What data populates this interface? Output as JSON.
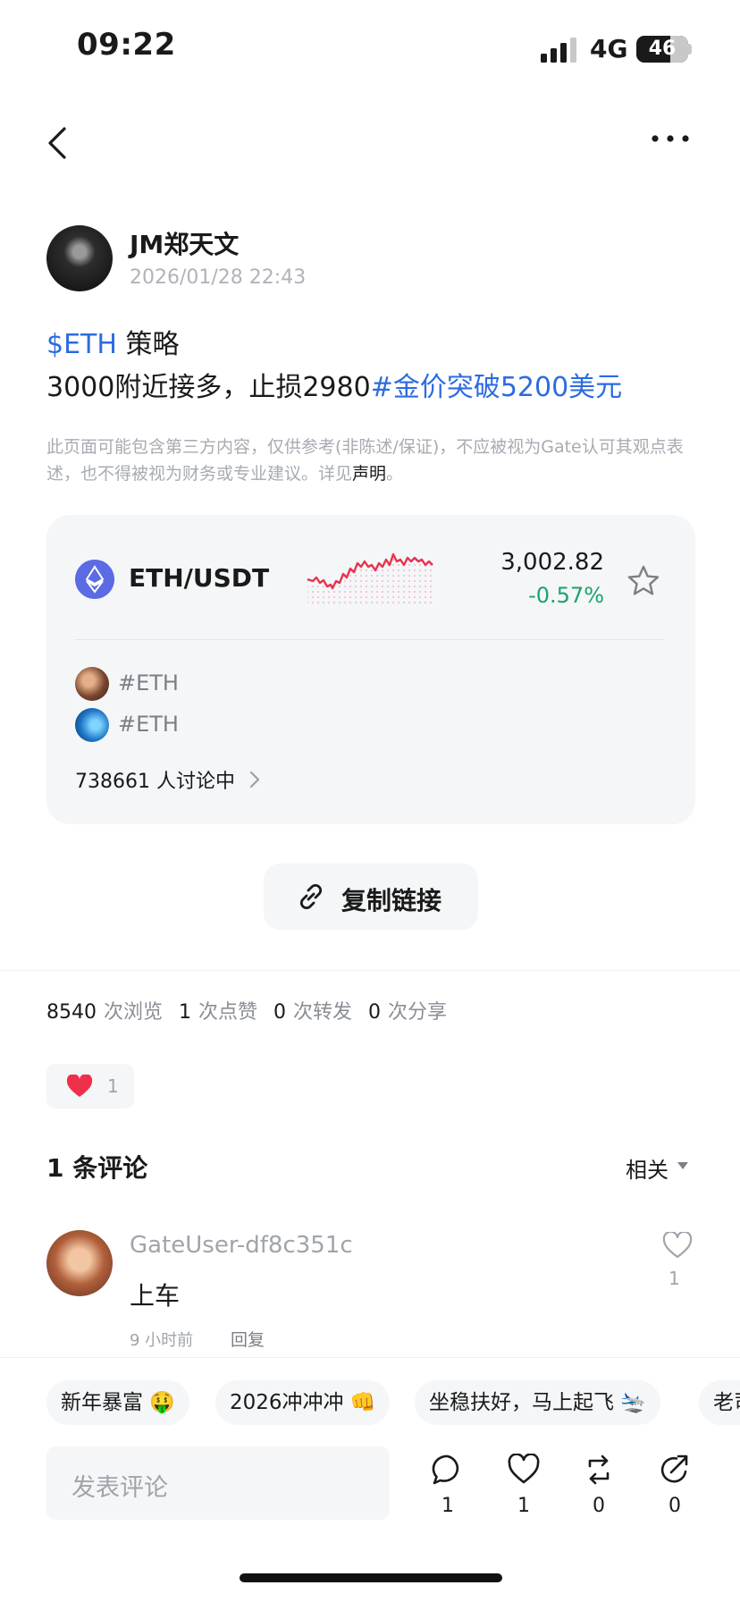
{
  "status_bar": {
    "time": "09:22",
    "network": "4G",
    "battery": "46"
  },
  "post": {
    "author": "JM郑天文",
    "date": "2026/01/28 22:43",
    "ticker_tag": "$ETH",
    "line1_rest": " 策略",
    "line2_text": "3000附近接多，止损2980",
    "hashtag": "#金价突破5200美元",
    "disclaimer_text": "此页面可能包含第三方内容，仅供参考(非陈述/保证)，不应被视为Gate认可其观点表述，也不得被视为财务或专业建议。详见",
    "disclaimer_link": "声明",
    "disclaimer_end": "。"
  },
  "ticker_card": {
    "pair": "ETH/USDT",
    "price": "3,002.82",
    "change": "-0.57%",
    "tags": [
      "#ETH",
      "#ETH"
    ],
    "discussion": "738661 人讨论中"
  },
  "copy_link": {
    "label": "复制链接"
  },
  "stats": {
    "views": "8540",
    "views_label": "次浏览",
    "likes": "1",
    "likes_label": "次点赞",
    "reposts": "0",
    "reposts_label": "次转发",
    "shares": "0",
    "shares_label": "次分享"
  },
  "reaction": {
    "count": "1"
  },
  "comments": {
    "title": "1 条评论",
    "sort": "相关",
    "items": [
      {
        "user": "GateUser-df8c351c",
        "text": "上车",
        "time": "9 小时前",
        "reply": "回复",
        "likes": "1"
      }
    ]
  },
  "quick_replies": [
    "新年暴富 🤑",
    "2026冲冲冲 👊",
    "坐稳扶好，马上起飞 🛬",
    "老司"
  ],
  "composer": {
    "placeholder": "发表评论"
  },
  "actions": {
    "comment": "1",
    "like": "1",
    "repost": "0",
    "share": "0"
  },
  "colors": {
    "accent_blue": "#2c6be0",
    "down_green": "#1ba36b",
    "sparkline_red": "#e8344e",
    "heart_red": "#f0304a"
  }
}
